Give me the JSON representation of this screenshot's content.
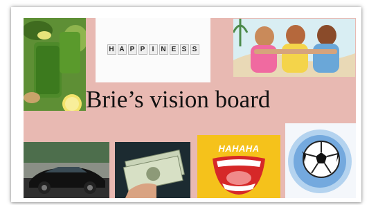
{
  "board": {
    "title": "Brie’s vision board",
    "background_color": "#e8b9b2"
  },
  "tiles": {
    "happiness": {
      "letters": [
        "H",
        "A",
        "P",
        "P",
        "I",
        "N",
        "E",
        "S",
        "S"
      ]
    },
    "hahaha": {
      "text": "HAHAHA"
    }
  },
  "images": [
    {
      "name": "green-juice-image",
      "icon": "green-smoothie"
    },
    {
      "name": "friends-image",
      "icon": "three-friends-hugging"
    },
    {
      "name": "car-image",
      "icon": "black-sports-car"
    },
    {
      "name": "money-image",
      "icon": "cash-in-hand"
    },
    {
      "name": "laughing-mouth-image",
      "icon": "laughing-mouth"
    },
    {
      "name": "soccer-ball-image",
      "icon": "soccer-ball"
    }
  ]
}
